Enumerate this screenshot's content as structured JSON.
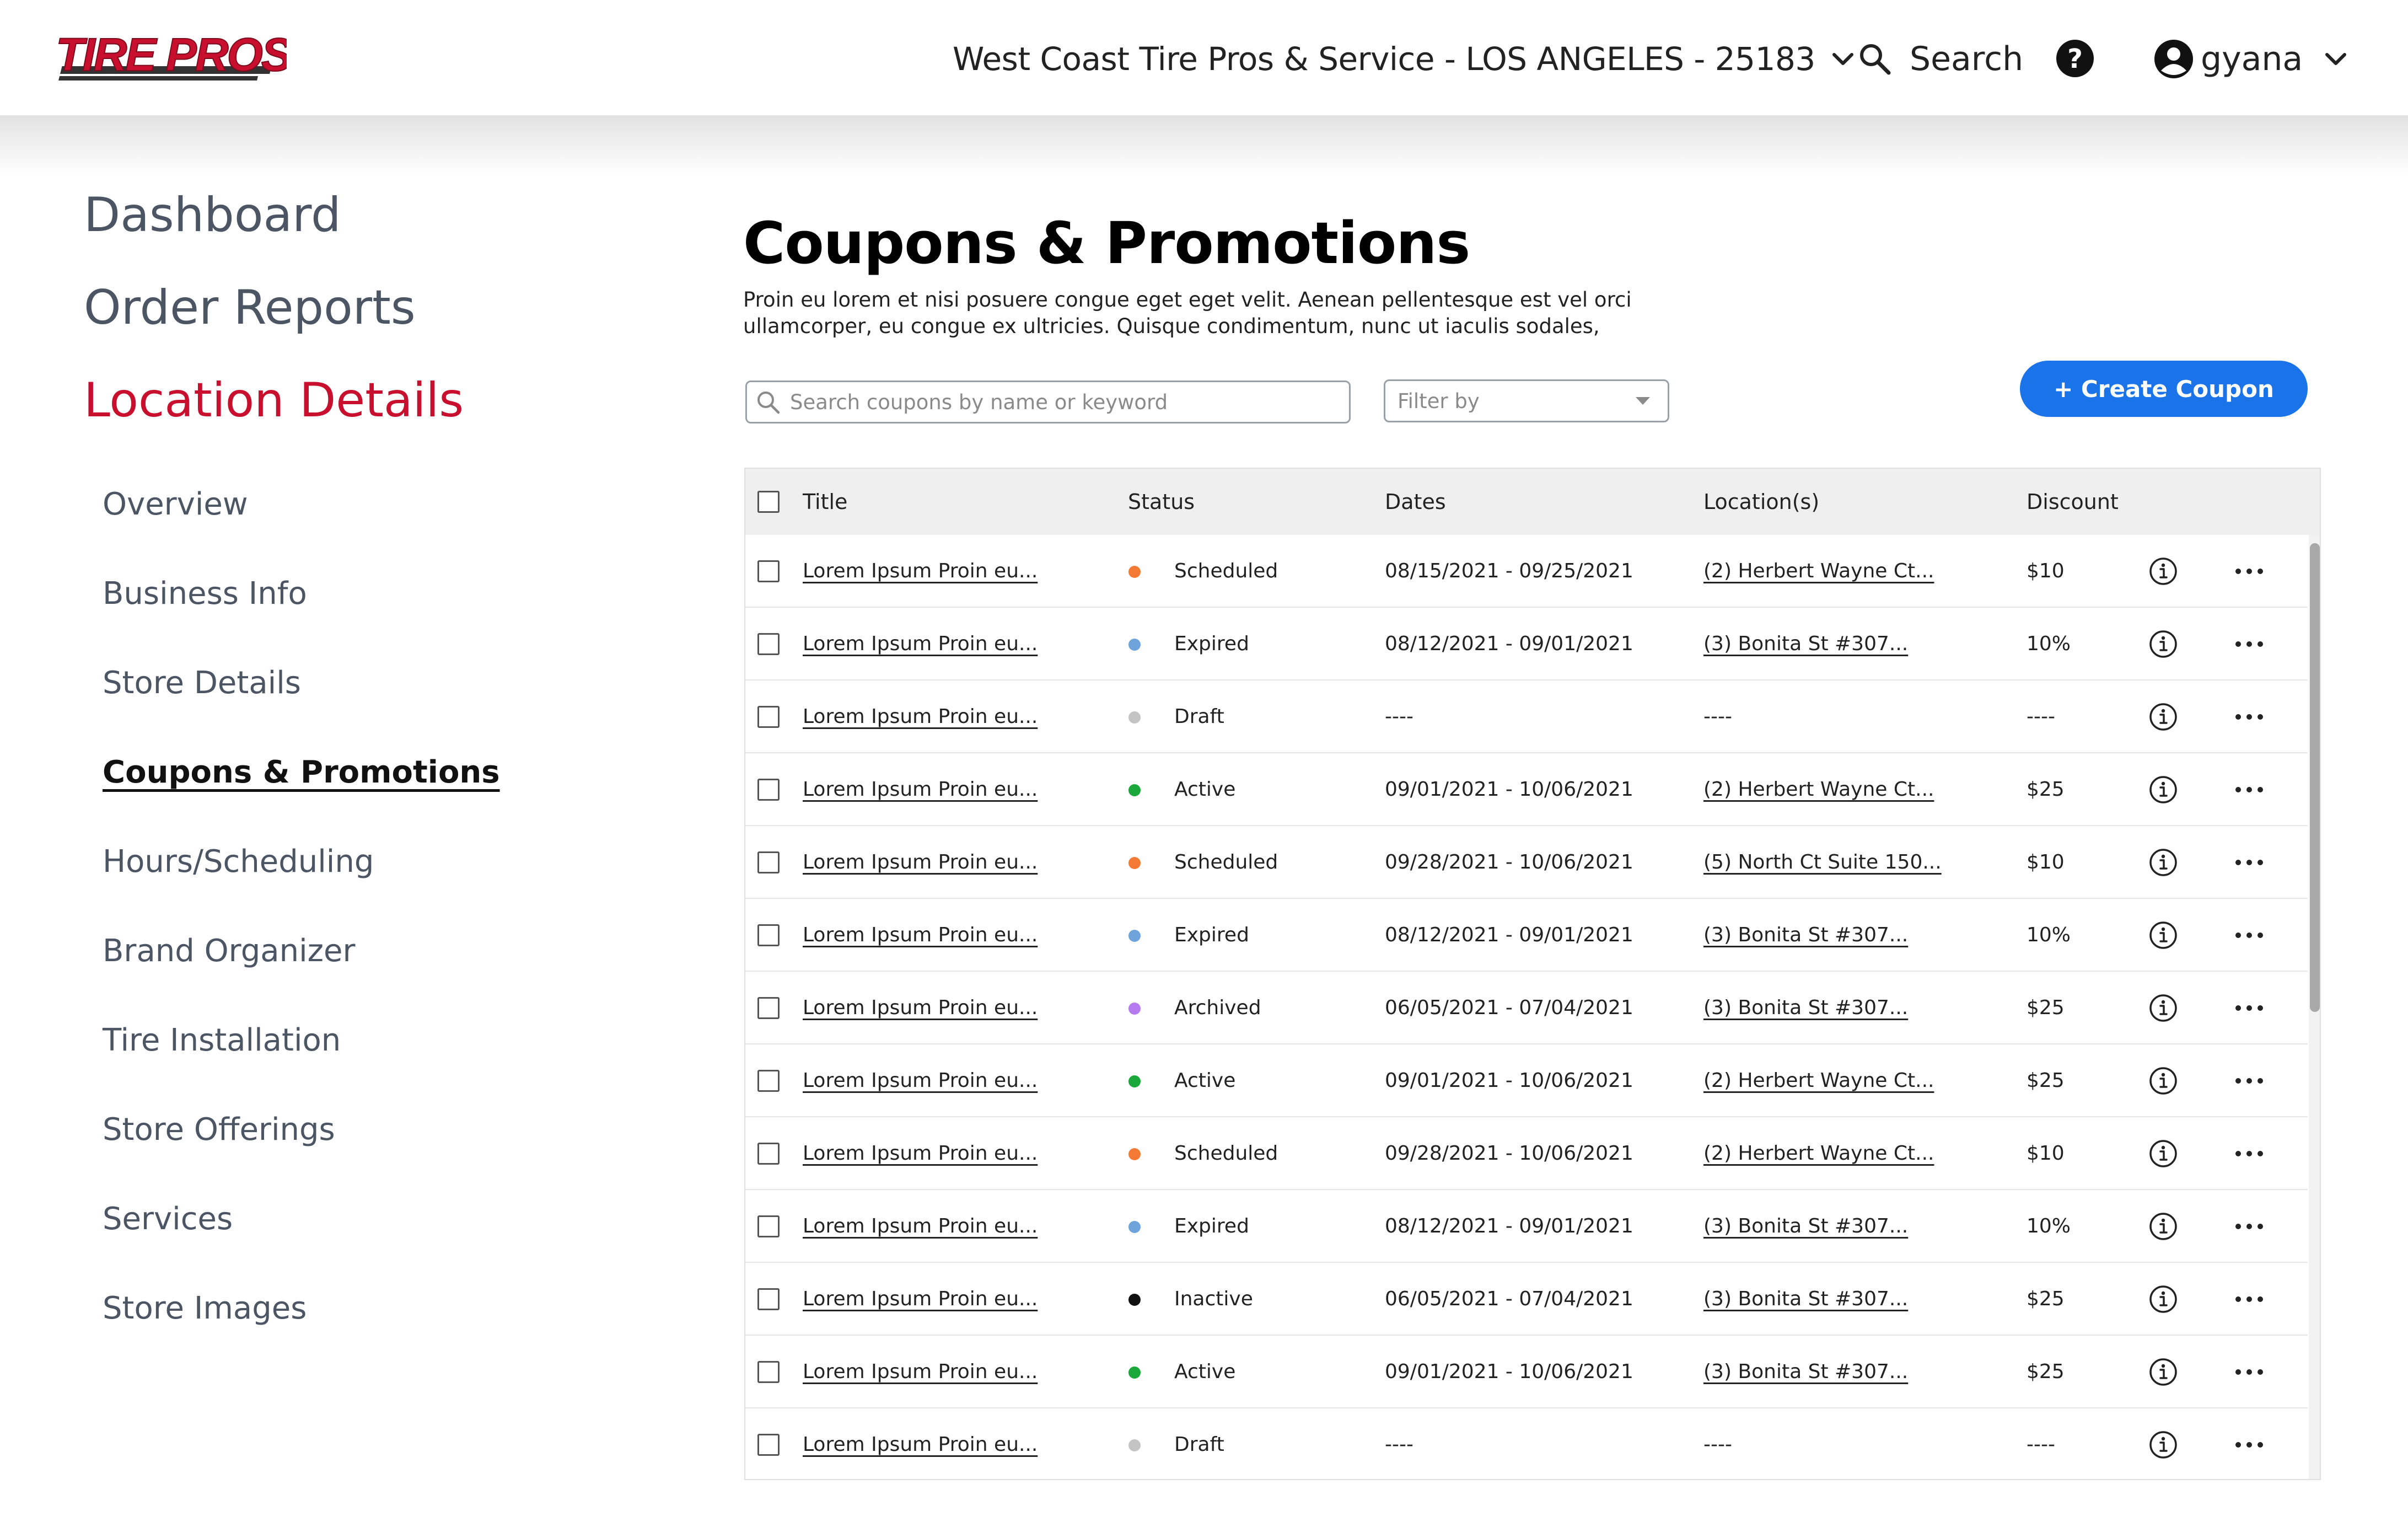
{
  "header": {
    "logo_text": "TIRE PROS",
    "location_label": "West Coast Tire Pros & Service - LOS ANGELES - 25183",
    "search_label": "Search",
    "user_label": "gyana",
    "brand_color": "#c8102e"
  },
  "sidebar": {
    "main": [
      {
        "label": "Dashboard"
      },
      {
        "label": "Order Reports"
      },
      {
        "label": "Location Details"
      }
    ],
    "sub": [
      {
        "label": "Overview"
      },
      {
        "label": "Business Info"
      },
      {
        "label": "Store Details"
      },
      {
        "label": "Coupons & Promotions"
      },
      {
        "label": "Hours/Scheduling"
      },
      {
        "label": "Brand Organizer"
      },
      {
        "label": "Tire Installation"
      },
      {
        "label": "Store Offerings"
      },
      {
        "label": "Services"
      },
      {
        "label": "Store Images"
      }
    ],
    "active_sub": "Coupons & Promotions"
  },
  "main": {
    "title": "Coupons & Promotions",
    "description": "Proin eu lorem et nisi posuere congue eget eget velit. Aenean pellentesque est vel orci ullamcorper, eu congue ex ultricies. Quisque condimentum, nunc ut iaculis sodales,",
    "search_placeholder": "Search coupons by name or keyword",
    "filter_label": "Filter by",
    "create_label": "+ Create Coupon",
    "accent_color": "#1a73e8"
  },
  "table": {
    "columns": [
      "Title",
      "Status",
      "Dates",
      "Location(s)",
      "Discount"
    ],
    "status_colors": {
      "Scheduled": "#f47a36",
      "Expired": "#6fa3dc",
      "Draft": "#c4c4c4",
      "Active": "#1aa83a",
      "Archived": "#b57bef",
      "Inactive": "#111111"
    },
    "rows": [
      {
        "title": "Lorem Ipsum Proin eu...",
        "status": "Scheduled",
        "dates": "08/15/2021 - 09/25/2021",
        "locations": "(2) Herbert Wayne Ct...",
        "discount": "$10"
      },
      {
        "title": "Lorem Ipsum Proin eu...",
        "status": "Expired",
        "dates": "08/12/2021 - 09/01/2021",
        "locations": "(3) Bonita St #307...",
        "discount": "10%"
      },
      {
        "title": "Lorem Ipsum Proin eu...",
        "status": "Draft",
        "dates": "----",
        "locations": "----",
        "discount": "----"
      },
      {
        "title": "Lorem Ipsum Proin eu...",
        "status": "Active",
        "dates": "09/01/2021 - 10/06/2021",
        "locations": "(2) Herbert Wayne Ct...",
        "discount": "$25"
      },
      {
        "title": "Lorem Ipsum Proin eu...",
        "status": "Scheduled",
        "dates": "09/28/2021 - 10/06/2021",
        "locations": "(5) North Ct Suite 150...",
        "discount": "$10"
      },
      {
        "title": "Lorem Ipsum Proin eu...",
        "status": "Expired",
        "dates": "08/12/2021 - 09/01/2021",
        "locations": "(3) Bonita St #307...",
        "discount": "10%"
      },
      {
        "title": "Lorem Ipsum Proin eu...",
        "status": "Archived",
        "dates": "06/05/2021 - 07/04/2021",
        "locations": "(3) Bonita St #307...",
        "discount": "$25"
      },
      {
        "title": "Lorem Ipsum Proin eu...",
        "status": "Active",
        "dates": "09/01/2021 - 10/06/2021",
        "locations": "(2) Herbert Wayne Ct...",
        "discount": "$25"
      },
      {
        "title": "Lorem Ipsum Proin eu...",
        "status": "Scheduled",
        "dates": "09/28/2021 - 10/06/2021",
        "locations": "(2) Herbert Wayne Ct...",
        "discount": "$10"
      },
      {
        "title": "Lorem Ipsum Proin eu...",
        "status": "Expired",
        "dates": "08/12/2021 - 09/01/2021",
        "locations": "(3) Bonita St #307...",
        "discount": "10%"
      },
      {
        "title": "Lorem Ipsum Proin eu...",
        "status": "Inactive",
        "dates": "06/05/2021 - 07/04/2021",
        "locations": "(3) Bonita St #307...",
        "discount": "$25"
      },
      {
        "title": "Lorem Ipsum Proin eu...",
        "status": "Active",
        "dates": "09/01/2021 - 10/06/2021",
        "locations": "(3) Bonita St #307...",
        "discount": "$25"
      },
      {
        "title": "Lorem Ipsum Proin eu...",
        "status": "Draft",
        "dates": "----",
        "locations": "----",
        "discount": "----"
      }
    ]
  }
}
